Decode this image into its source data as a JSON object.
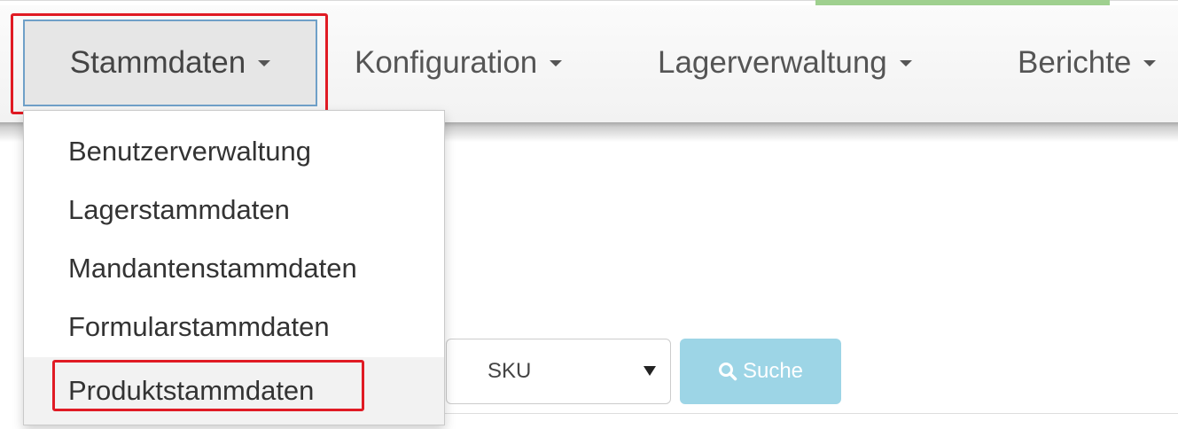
{
  "navbar": {
    "items": [
      {
        "label": "Stammdaten",
        "active": true
      },
      {
        "label": "Konfiguration"
      },
      {
        "label": "Lagerverwaltung"
      },
      {
        "label": "Berichte"
      }
    ]
  },
  "dropdown": {
    "items": [
      {
        "label": "Benutzerverwaltung"
      },
      {
        "label": "Lagerstammdaten"
      },
      {
        "label": "Mandantenstammdaten"
      },
      {
        "label": "Formularstammdaten"
      },
      {
        "label": "Produktstammdaten",
        "hovered": true
      }
    ]
  },
  "search": {
    "field_select": "SKU",
    "button_label": "Suche"
  },
  "colors": {
    "highlight": "#e01b24",
    "search_button": "#9dd5e6",
    "top_tab": "#9fd08f"
  },
  "icons": [
    "caret-down-icon",
    "search-icon"
  ]
}
